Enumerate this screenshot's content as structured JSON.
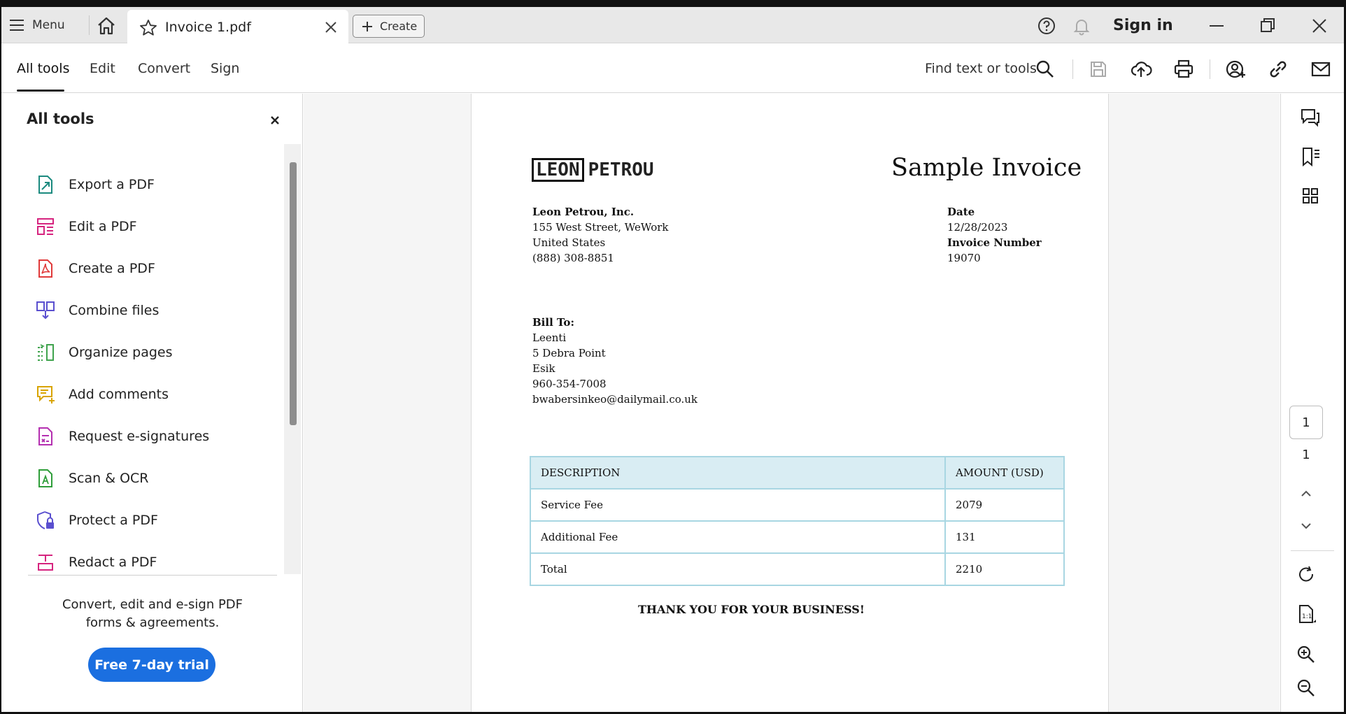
{
  "titlebar": {
    "menu_label": "Menu",
    "tab_title": "Invoice 1.pdf",
    "create_label": "Create",
    "sign_in": "Sign in"
  },
  "toolbar": {
    "tabs": [
      {
        "label": "All tools"
      },
      {
        "label": "Edit"
      },
      {
        "label": "Convert"
      },
      {
        "label": "Sign"
      }
    ],
    "find_text": "Find text or tools"
  },
  "left_panel": {
    "title": "All tools",
    "tools": [
      {
        "label": "Export a PDF",
        "icon": "export-pdf-icon",
        "color": "#1b8a7f"
      },
      {
        "label": "Edit a PDF",
        "icon": "edit-pdf-icon",
        "color": "#d6247f"
      },
      {
        "label": "Create a PDF",
        "icon": "create-pdf-icon",
        "color": "#e03a3a"
      },
      {
        "label": "Combine files",
        "icon": "combine-files-icon",
        "color": "#5a4fcf"
      },
      {
        "label": "Organize pages",
        "icon": "organize-pages-icon",
        "color": "#3fa34d"
      },
      {
        "label": "Add comments",
        "icon": "add-comments-icon",
        "color": "#d9a400"
      },
      {
        "label": "Request e-signatures",
        "icon": "request-esign-icon",
        "color": "#b42fb0"
      },
      {
        "label": "Scan & OCR",
        "icon": "scan-ocr-icon",
        "color": "#2f9e3a"
      },
      {
        "label": "Protect a PDF",
        "icon": "protect-pdf-icon",
        "color": "#5a4fcf"
      },
      {
        "label": "Redact a PDF",
        "icon": "redact-pdf-icon",
        "color": "#d6247f"
      }
    ],
    "promo_line1": "Convert, edit and e-sign PDF",
    "promo_line2": "forms & agreements.",
    "trial_button": "Free 7-day trial"
  },
  "document": {
    "logo_boxed": "LEON",
    "logo_rest": "PETROU",
    "title": "Sample Invoice",
    "company": {
      "name": "Leon Petrou, Inc.",
      "street": "155 West Street, WeWork",
      "country": "United States",
      "phone": "(888) 308-8851"
    },
    "meta": {
      "date_label": "Date",
      "date_value": "12/28/2023",
      "number_label": "Invoice Number",
      "number_value": "19070"
    },
    "bill_to": {
      "label": "Bill To:",
      "name": "Leenti",
      "street": "5 Debra Point",
      "city": "Esik",
      "phone": "960-354-7008",
      "email": "bwabersinkeo@dailymail.co.uk"
    },
    "table": {
      "headers": [
        "DESCRIPTION",
        "AMOUNT (USD)"
      ],
      "rows": [
        [
          "Service Fee",
          "2079"
        ],
        [
          "Additional Fee",
          "131"
        ],
        [
          "Total",
          "2210"
        ]
      ]
    },
    "thanks": "THANK YOU FOR YOUR BUSINESS!"
  },
  "right_rail": {
    "current_page": "1",
    "total_pages": "1"
  }
}
